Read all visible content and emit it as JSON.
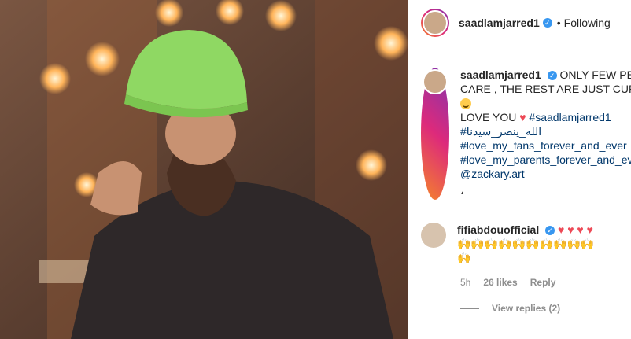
{
  "post": {
    "username": "saadlamjarred1",
    "follow_status": "Following",
    "dot": "•",
    "caption": {
      "username": "saadlamjarred1",
      "line1": "ONLY FEW PEOP",
      "line2": "CARE , THE REST ARE JUST CURIOU",
      "line3": "LOVE YOU",
      "hashtag1": "#saadlamjarred1",
      "hashtag2": "#الله_ينصر_سيدنا",
      "hashtag3": "#love_my_fans_forever_and_ever",
      "hashtag4": "#love_my_parents_forever_and_eve",
      "mention": "@zackary.art",
      "extra": "،"
    }
  },
  "comment": {
    "username": "fifiabdouofficial",
    "hearts": "♥ ♥ ♥ ♥",
    "emoji_line1": "🙌🙌🙌🙌🙌🙌🙌🙌🙌🙌",
    "emoji_line2": "🙌",
    "time": "5h",
    "likes": "26 likes",
    "reply": "Reply",
    "view_replies": "View replies (2)"
  },
  "colors": {
    "verified": "#3897f0",
    "heart": "#ed4956",
    "link": "#00376b",
    "beanie": "#8fd863",
    "sweater": "#2e2829"
  }
}
